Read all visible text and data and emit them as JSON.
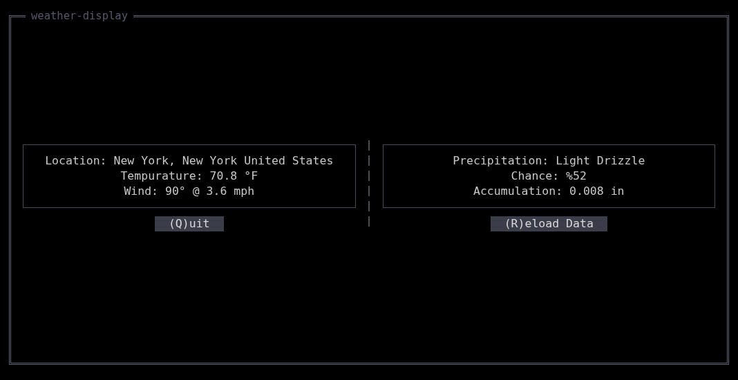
{
  "window": {
    "title": "weather-display"
  },
  "panels": [
    {
      "lines": [
        "Location: New York, New York United States",
        "Tempurature: 70.8 °F",
        "Wind: 90° @ 3.6 mph"
      ],
      "button": "(Q)uit"
    },
    {
      "lines": [
        "Precipitation: Light Drizzle",
        "Chance: %52",
        "Accumulation: 0.008 in"
      ],
      "button": "(R)eload Data"
    }
  ]
}
